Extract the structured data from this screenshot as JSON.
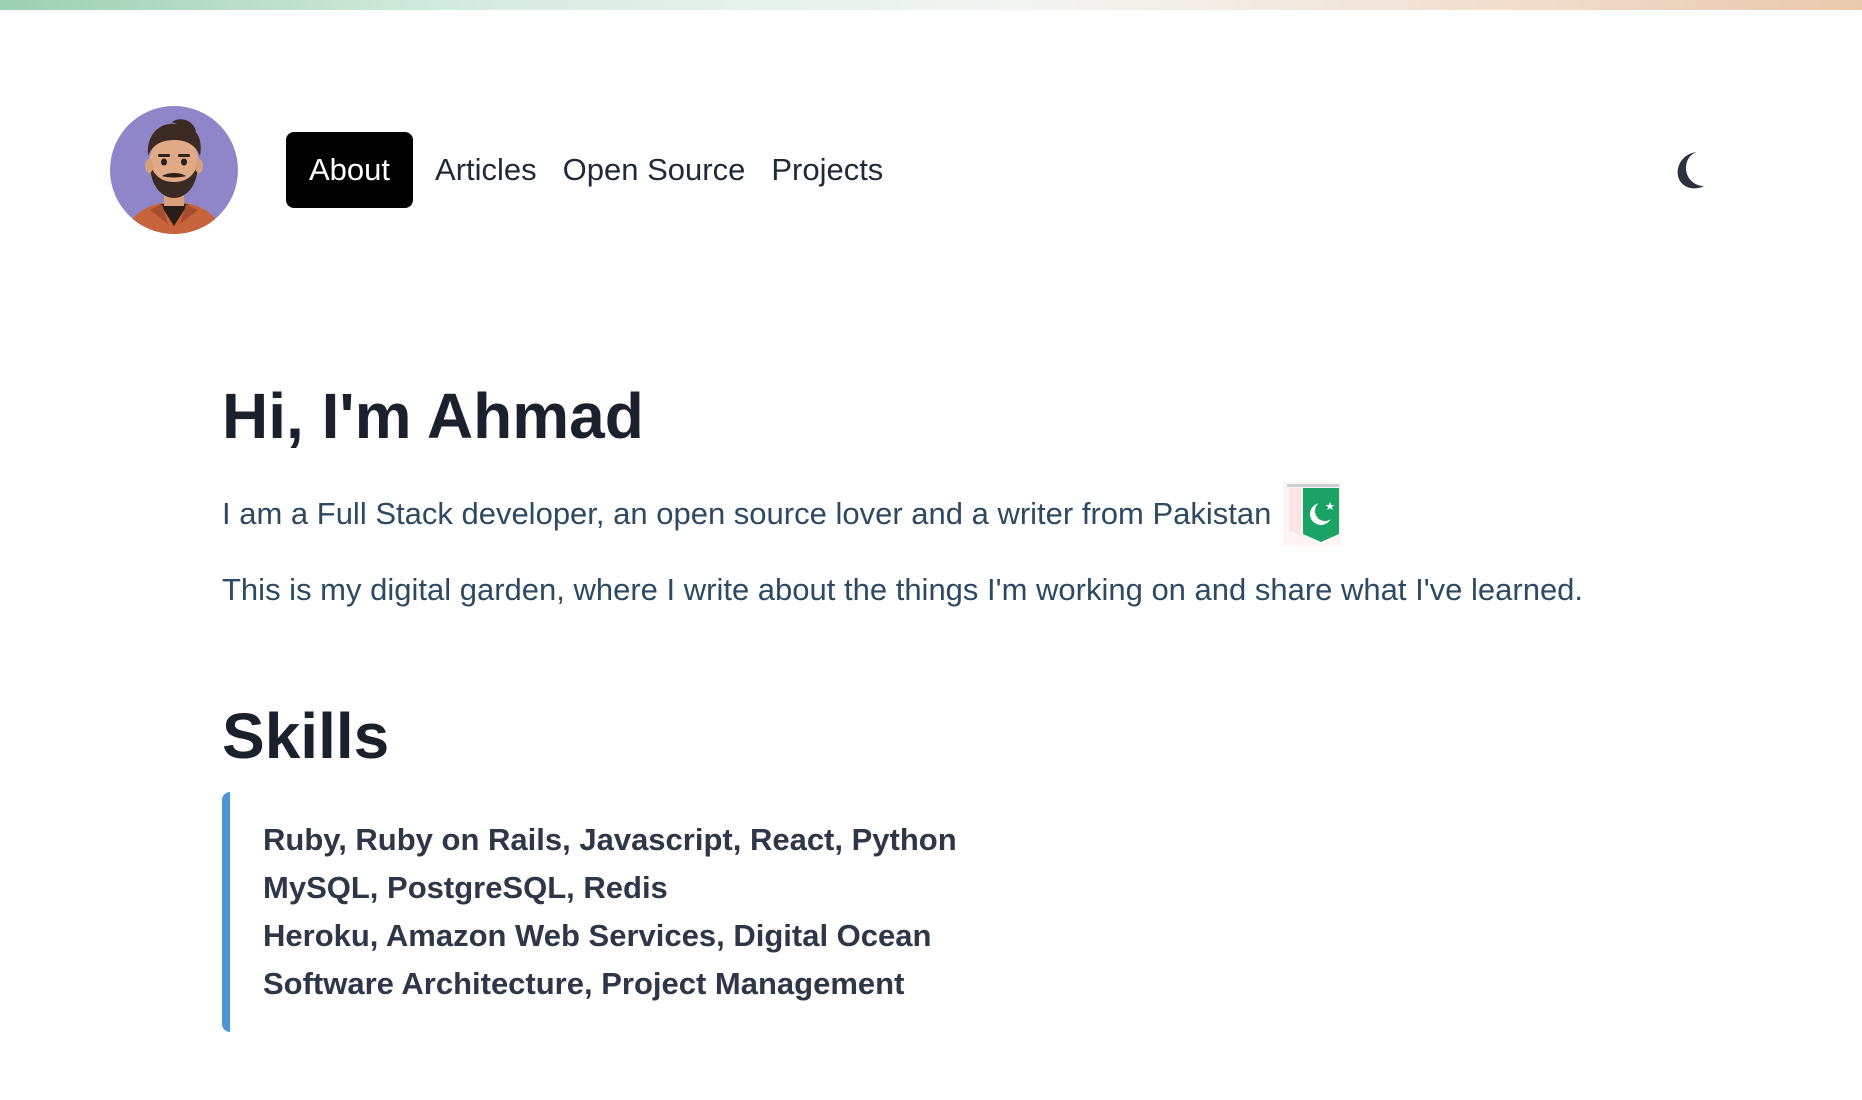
{
  "header": {
    "avatar_alt": "Ahmad avatar",
    "nav": [
      {
        "label": "About",
        "active": true
      },
      {
        "label": "Articles",
        "active": false
      },
      {
        "label": "Open Source",
        "active": false
      },
      {
        "label": "Projects",
        "active": false
      }
    ],
    "theme_icon": "moon-icon"
  },
  "hero": {
    "title": "Hi, I'm Ahmad",
    "intro": "I am a Full Stack developer, an open source lover and a writer from Pakistan",
    "flag_icon": "pakistan-flag-icon",
    "garden": "This is my digital garden, where I write about the things I'm working on and share what I've learned."
  },
  "skills": {
    "title": "Skills",
    "lines": [
      "Ruby, Ruby on Rails, Javascript, React, Python",
      "MySQL, PostgreSQL, Redis",
      "Heroku, Amazon Web Services, Digital Ocean",
      "Software Architecture, Project Management"
    ]
  },
  "colors": {
    "accent_border": "#4d96d6",
    "avatar_bg": "#8f86c9",
    "active_nav_bg": "#000000",
    "flag_green": "#1aa364"
  }
}
